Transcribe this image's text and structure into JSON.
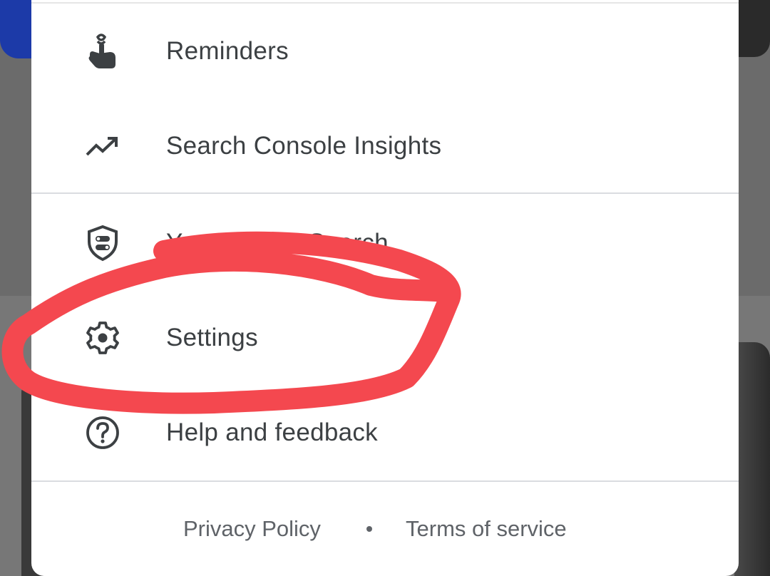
{
  "menu": {
    "items": [
      {
        "label": "Reminders",
        "icon": "reminder-finger-icon"
      },
      {
        "label": "Search Console Insights",
        "icon": "trending-up-icon"
      },
      {
        "label": "Your data in Search",
        "icon": "shield-toggle-icon"
      },
      {
        "label": "Settings",
        "icon": "gear-icon"
      },
      {
        "label": "Help and feedback",
        "icon": "help-circle-icon"
      }
    ]
  },
  "footer": {
    "privacy_label": "Privacy Policy",
    "terms_label": "Terms of service"
  },
  "colors": {
    "annotation": "#f4484f",
    "text": "#3c4043",
    "footer_text": "#5f6368"
  }
}
